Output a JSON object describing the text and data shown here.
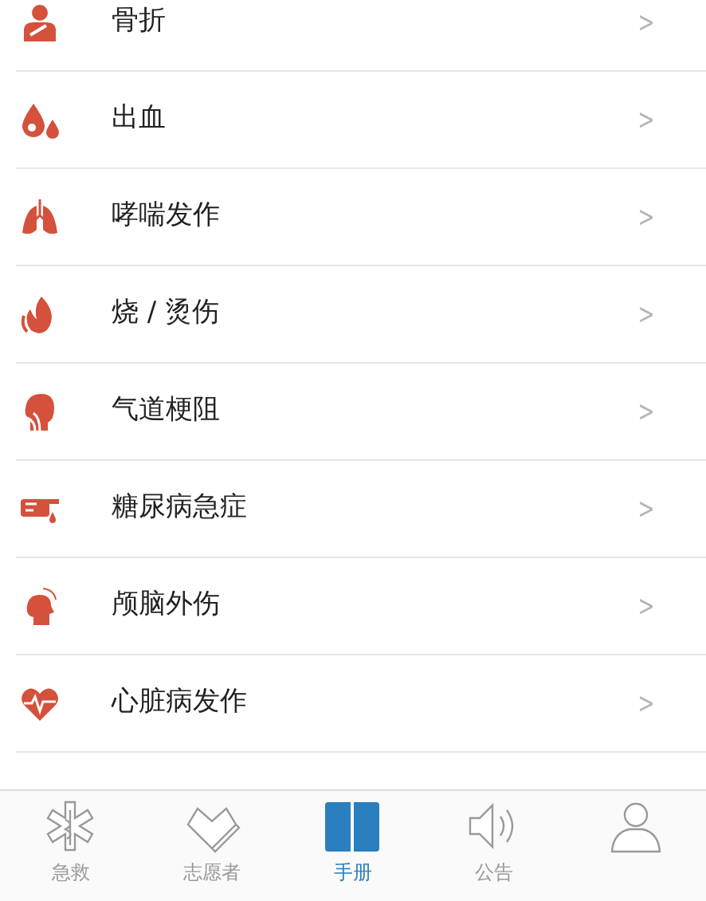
{
  "items": [
    {
      "kind": "fracture",
      "label": "骨折",
      "chevron": ">"
    },
    {
      "kind": "bleeding",
      "label": "出血",
      "chevron": ">"
    },
    {
      "kind": "lungs",
      "label": "哮喘发作",
      "chevron": ">"
    },
    {
      "kind": "burn",
      "label": "烧 / 烫伤",
      "chevron": ">"
    },
    {
      "kind": "choking",
      "label": "气道梗阻",
      "chevron": ">"
    },
    {
      "kind": "diabetes",
      "label": "糖尿病急症",
      "chevron": ">"
    },
    {
      "kind": "head",
      "label": "颅脑外伤",
      "chevron": ">"
    },
    {
      "kind": "heart",
      "label": "心脏病发作",
      "chevron": ">"
    }
  ],
  "tabs": [
    {
      "kind": "rescue",
      "label": "急救",
      "selected": false
    },
    {
      "kind": "volunteer",
      "label": "志愿者",
      "selected": false
    },
    {
      "kind": "manual",
      "label": "手册",
      "selected": true
    },
    {
      "kind": "notice",
      "label": "公告",
      "selected": false
    },
    {
      "kind": "profile",
      "selected": false
    }
  ]
}
